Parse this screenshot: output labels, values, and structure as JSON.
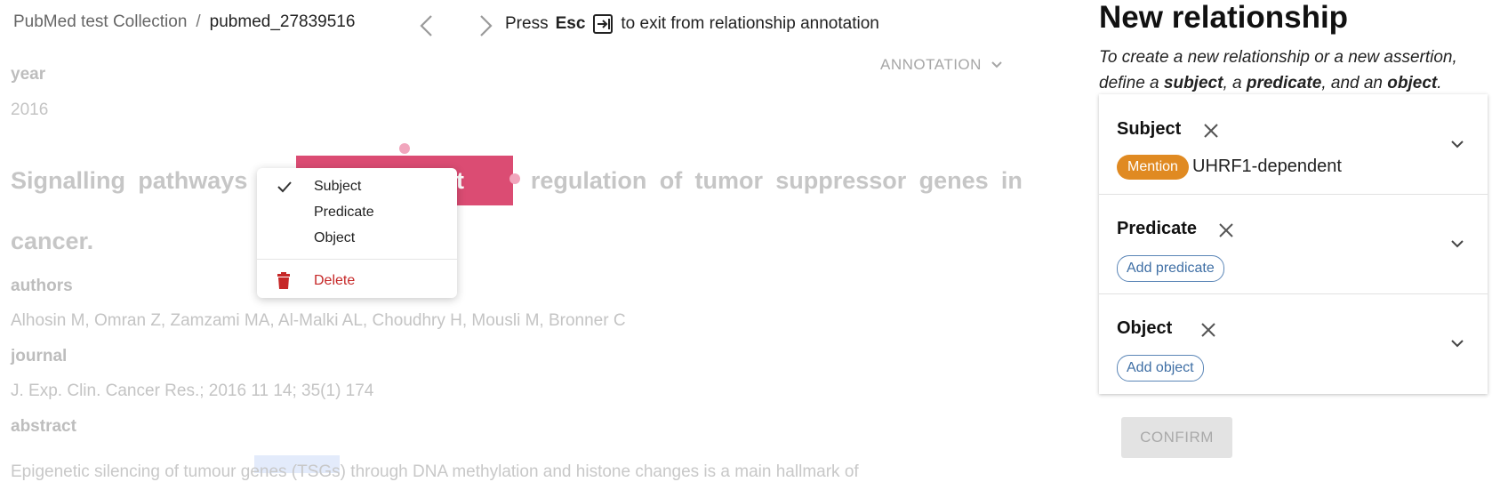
{
  "header": {
    "breadcrumb_root": "PubMed test Collection",
    "breadcrumb_sep": "/",
    "breadcrumb_doc": "pubmed_27839516",
    "esc_prefix": "Press",
    "esc_key": "Esc",
    "esc_suffix": "to exit from relationship annotation",
    "annotation_toggle": "ANNOTATION"
  },
  "document": {
    "year_label": "year",
    "year_value": "2016",
    "title_line1_words": [
      "Signalling",
      "pathways",
      "",
      "",
      "regulation",
      "of",
      "tumor",
      "suppressor",
      "genes",
      "in"
    ],
    "title_visible_fragment": "dent",
    "title_line2": "cancer.",
    "authors_label": "authors",
    "authors_value": "Alhosin M, Omran Z, Zamzami MA, Al-Malki AL, Choudhry H, Mousli M, Bronner C",
    "journal_label": "journal",
    "journal_value": "J. Exp. Clin. Cancer Res.; 2016 11 14; 35(1) 174",
    "abstract_label": "abstract",
    "abstract_value": "Epigenetic silencing of tumour                       genes (TSGs) through DNA methylation and histone changes is a main hallmark of"
  },
  "context_menu": {
    "items": [
      {
        "label": "Subject",
        "checked": true
      },
      {
        "label": "Predicate",
        "checked": false
      },
      {
        "label": "Object",
        "checked": false
      }
    ],
    "delete_label": "Delete"
  },
  "panel": {
    "title": "New relationship",
    "desc_1": "To create a new relationship or a new assertion, define a",
    "desc_subject": "subject",
    "desc_2": ", a",
    "desc_predicate": "predicate",
    "desc_3": ", and an",
    "desc_object": "object",
    "desc_4": ".",
    "subject_title": "Subject",
    "subject_chip": "Mention",
    "subject_value": "UHRF1-dependent",
    "predicate_title": "Predicate",
    "predicate_add": "Add predicate",
    "object_title": "Object",
    "object_add": "Add object",
    "confirm_label": "CONFIRM"
  },
  "colors": {
    "highlight": "#db4c73",
    "mention_chip": "#e08a22",
    "delete": "#c62828",
    "add_chip_border": "#5b86b7"
  },
  "icons": [
    "chevron-left-icon",
    "chevron-right-icon",
    "exit-icon",
    "chevron-down-icon",
    "check-icon",
    "trash-icon",
    "close-icon",
    "expand-icon"
  ]
}
